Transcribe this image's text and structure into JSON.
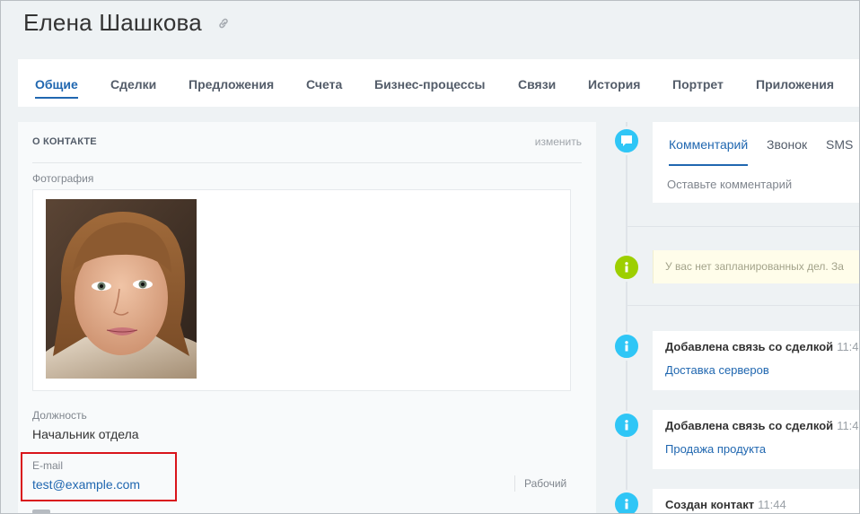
{
  "header": {
    "title": "Елена Шашкова"
  },
  "tabs": [
    {
      "label": "Общие",
      "active": true
    },
    {
      "label": "Сделки"
    },
    {
      "label": "Предложения"
    },
    {
      "label": "Счета"
    },
    {
      "label": "Бизнес-процессы"
    },
    {
      "label": "Связи"
    },
    {
      "label": "История"
    },
    {
      "label": "Портрет"
    },
    {
      "label": "Приложения"
    }
  ],
  "contact": {
    "section_title": "О КОНТАКТЕ",
    "edit_label": "изменить",
    "photo_label": "Фотография",
    "position_label": "Должность",
    "position_value": "Начальник отдела",
    "email_label": "E-mail",
    "email_value": "test@example.com",
    "email_type": "Рабочий"
  },
  "timeline": {
    "comment_tabs": [
      "Комментарий",
      "Звонок",
      "SMS"
    ],
    "comment_placeholder": "Оставьте комментарий",
    "notice": "У вас нет запланированных дел. За",
    "events": [
      {
        "title": "Добавлена связь со сделкой",
        "time": "11:4",
        "link": "Доставка серверов"
      },
      {
        "title": "Добавлена связь со сделкой",
        "time": "11:4",
        "link": "Продажа продукта"
      },
      {
        "title": "Создан контакт",
        "time": "11:44"
      }
    ]
  },
  "colors": {
    "accent": "#2067b0",
    "timeline_blue": "#2fc6f6",
    "timeline_green": "#9dcf00",
    "highlight": "#d9141b"
  }
}
